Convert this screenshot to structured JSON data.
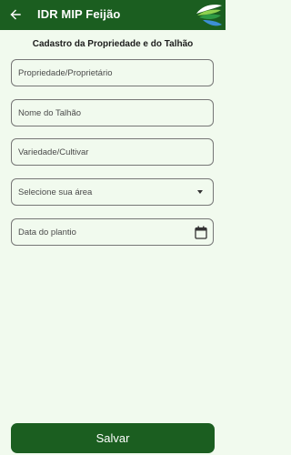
{
  "app_bar": {
    "title": "IDR MIP Feijão",
    "back_icon": "arrow-left-icon",
    "logo": "idr-logo",
    "background": "#1b5e20"
  },
  "form": {
    "title": "Cadastro da Propriedade e do Talhão",
    "fields": [
      {
        "placeholder": "Propriedade/Proprietário",
        "type": "text"
      },
      {
        "placeholder": "Nome do Talhão",
        "type": "text"
      },
      {
        "placeholder": "Variedade/Cultivar",
        "type": "text"
      },
      {
        "placeholder": "Selecione sua área",
        "type": "dropdown",
        "icon": "dropdown-arrow-icon"
      },
      {
        "placeholder": "Data do plantio",
        "type": "date",
        "icon": "calendar-icon"
      }
    ]
  },
  "save_button": {
    "label": "Salvar",
    "background": "#1b5e20"
  }
}
